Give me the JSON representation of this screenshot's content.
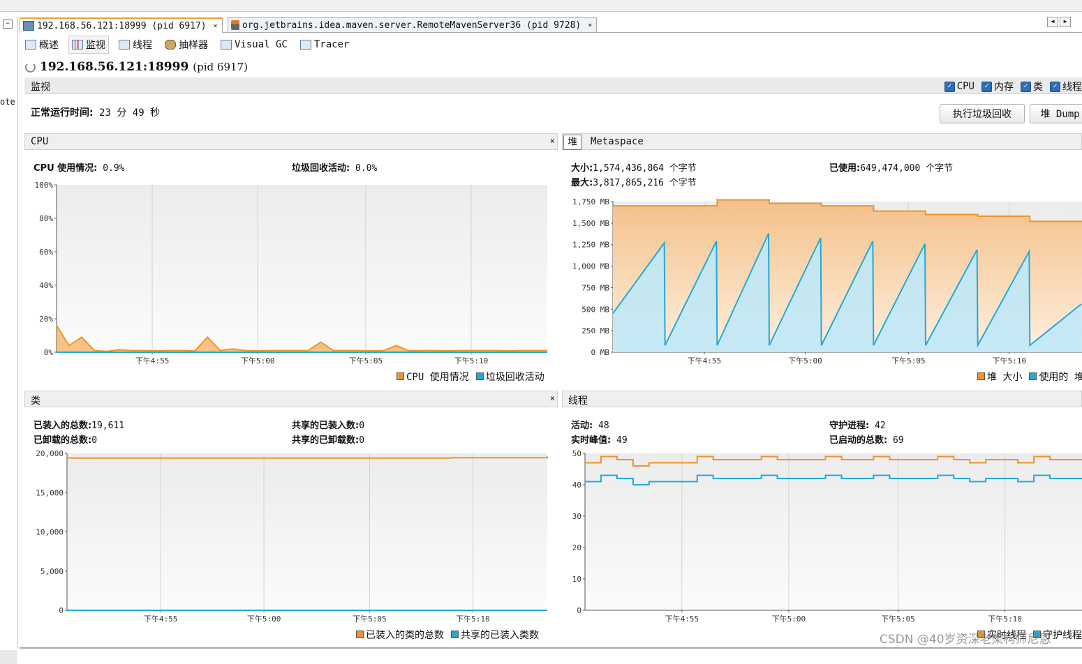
{
  "colors": {
    "orange": "#f0942a",
    "blue": "#23a9d7",
    "orange_fill_top": "#f4c08a",
    "blue_fill": "#bfe8f7",
    "checkbox": "#2f6fb6"
  },
  "left_strip": {
    "text": "ote"
  },
  "tabs": [
    {
      "label": "192.168.56.121:18999 (pid 6917)",
      "icon": "host-icon",
      "close": "×"
    },
    {
      "label": "org.jetbrains.idea.maven.server.RemoteMavenServer36 (pid 9728)",
      "icon": "java-icon",
      "close": "×"
    }
  ],
  "nav_arrows": [
    "◀",
    "▶"
  ],
  "subtabs": [
    {
      "label": "概述",
      "icon": "overview-icon"
    },
    {
      "label": "监视",
      "icon": "monitor-icon"
    },
    {
      "label": "线程",
      "icon": "threads-icon"
    },
    {
      "label": "抽样器",
      "icon": "sampler-icon"
    },
    {
      "label": "Visual GC",
      "icon": "visual-gc-icon"
    },
    {
      "label": "Tracer",
      "icon": "tracer-icon"
    }
  ],
  "process": {
    "host": "192.168.56.121:18999",
    "pid": "(pid 6917)"
  },
  "monitor": {
    "label": "监视",
    "checks": [
      {
        "label": "CPU",
        "checked": true
      },
      {
        "label": "内存",
        "checked": true
      },
      {
        "label": "类",
        "checked": true
      },
      {
        "label": "线程",
        "checked": true
      }
    ],
    "uptime_label": "正常运行时间:",
    "uptime_value": "23 分 49 秒",
    "gc_button": "执行垃圾回收",
    "dump_button": "堆 Dump"
  },
  "cpu_panel": {
    "title": "CPU",
    "close": "×",
    "usage_label": "CPU 使用情况:",
    "usage_value": "0.9%",
    "gc_label": "垃圾回收活动:",
    "gc_value": "0.0%",
    "legend": [
      "CPU 使用情况",
      "垃圾回收活动"
    ]
  },
  "heap_panel": {
    "tab_heap": "堆",
    "tab_meta": "Metaspace",
    "size_label": "大小:",
    "size_value": "1,574,436,864 个字节",
    "max_label": "最大:",
    "max_value": "3,817,865,216 个字节",
    "used_label": "已使用:",
    "used_value": "649,474,000 个字节",
    "legend": [
      "堆 大小",
      "使用的 堆"
    ]
  },
  "classes_panel": {
    "title": "类",
    "close": "×",
    "loaded_label": "已装入的总数:",
    "loaded_value": "19,611",
    "unloaded_label": "已卸载的总数:",
    "unloaded_value": "0",
    "shared_loaded_label": "共享的已装入数:",
    "shared_loaded_value": "0",
    "shared_unloaded_label": "共享的已卸载数:",
    "shared_unloaded_value": "0",
    "legend": [
      "已装入的类的总数",
      "共享的已装入类数"
    ]
  },
  "threads_panel": {
    "title": "线程",
    "live_label": "活动:",
    "live_value": "48",
    "peak_label": "实时峰值:",
    "peak_value": "49",
    "daemon_label": "守护进程:",
    "daemon_value": "42",
    "started_label": "已启动的总数:",
    "started_value": "69",
    "legend": [
      "实时线程",
      "守护线程"
    ]
  },
  "chart_data": [
    {
      "type": "area",
      "name": "cpu",
      "x_ticks": [
        "下午4:55",
        "下午5:00",
        "下午5:05",
        "下午5:10"
      ],
      "y_ticks": [
        "100%",
        "80%",
        "60%",
        "40%",
        "20%",
        "0%"
      ],
      "ylim": [
        0,
        100
      ],
      "series": [
        {
          "name": "CPU 使用情况",
          "values": [
            16,
            4,
            9,
            1,
            0.5,
            1.5,
            1,
            1,
            0.8,
            1,
            1,
            0.8,
            9,
            1,
            2,
            1,
            0.8,
            1,
            1,
            1,
            1,
            6,
            1,
            1,
            1,
            0.8,
            1,
            4,
            0.8,
            1,
            1,
            0.8,
            1,
            1,
            1,
            1,
            0.8,
            1,
            1,
            1
          ]
        },
        {
          "name": "垃圾回收活动",
          "values": [
            0,
            0,
            0,
            0,
            0,
            0,
            0,
            0,
            0,
            0
          ]
        }
      ]
    },
    {
      "type": "area",
      "name": "heap",
      "x_ticks": [
        "下午4:55",
        "下午5:00",
        "下午5:05",
        "下午5:10"
      ],
      "y_ticks": [
        "1,750 MB",
        "1,500 MB",
        "1,250 MB",
        "1,000 MB",
        "750 MB",
        "500 MB",
        "250 MB",
        "0 MB"
      ],
      "ylim": [
        0,
        1750
      ],
      "series": [
        {
          "name": "堆 大小",
          "steps": [
            1700,
            1700,
            1770,
            1730,
            1700,
            1640,
            1600,
            1580,
            1520
          ]
        },
        {
          "name": "使用的 堆",
          "teeth": [
            [
              450,
              1270
            ],
            [
              80,
              1290
            ],
            [
              80,
              1380
            ],
            [
              80,
              1330
            ],
            [
              80,
              1290
            ],
            [
              80,
              1260
            ],
            [
              80,
              1190
            ],
            [
              80,
              1170
            ],
            [
              80,
              560
            ]
          ]
        }
      ]
    },
    {
      "type": "line",
      "name": "classes",
      "x_ticks": [
        "下午4:55",
        "下午5:00",
        "下午5:05",
        "下午5:10"
      ],
      "y_ticks": [
        "20,000",
        "15,000",
        "10,000",
        "5,000",
        "0"
      ],
      "ylim": [
        0,
        20000
      ],
      "series": [
        {
          "name": "已装入的类的总数",
          "values": [
            19400,
            19400,
            19400,
            19400,
            19450,
            19611
          ]
        },
        {
          "name": "共享的已装入类数",
          "values": [
            0,
            0,
            0,
            0,
            0,
            0
          ]
        }
      ]
    },
    {
      "type": "line",
      "name": "threads",
      "x_ticks": [
        "下午4:55",
        "下午5:00",
        "下午5:05",
        "下午5:10"
      ],
      "y_ticks": [
        "50",
        "40",
        "30",
        "20",
        "10",
        "0"
      ],
      "ylim": [
        0,
        50
      ],
      "series": [
        {
          "name": "实时线程",
          "values": [
            47,
            49,
            48,
            46,
            47,
            47,
            47,
            49,
            48,
            48,
            48,
            49,
            48,
            48,
            48,
            49,
            48,
            48,
            49,
            48,
            48,
            48,
            49,
            48,
            47,
            48,
            48,
            47,
            49,
            48,
            48,
            48
          ]
        },
        {
          "name": "守护线程",
          "values": [
            41,
            43,
            42,
            40,
            41,
            41,
            41,
            43,
            42,
            42,
            42,
            43,
            42,
            42,
            42,
            43,
            42,
            42,
            43,
            42,
            42,
            42,
            43,
            42,
            41,
            42,
            42,
            41,
            43,
            42,
            42,
            42
          ]
        }
      ]
    }
  ],
  "watermark": "CSDN @40岁资深老架构师尼恩"
}
